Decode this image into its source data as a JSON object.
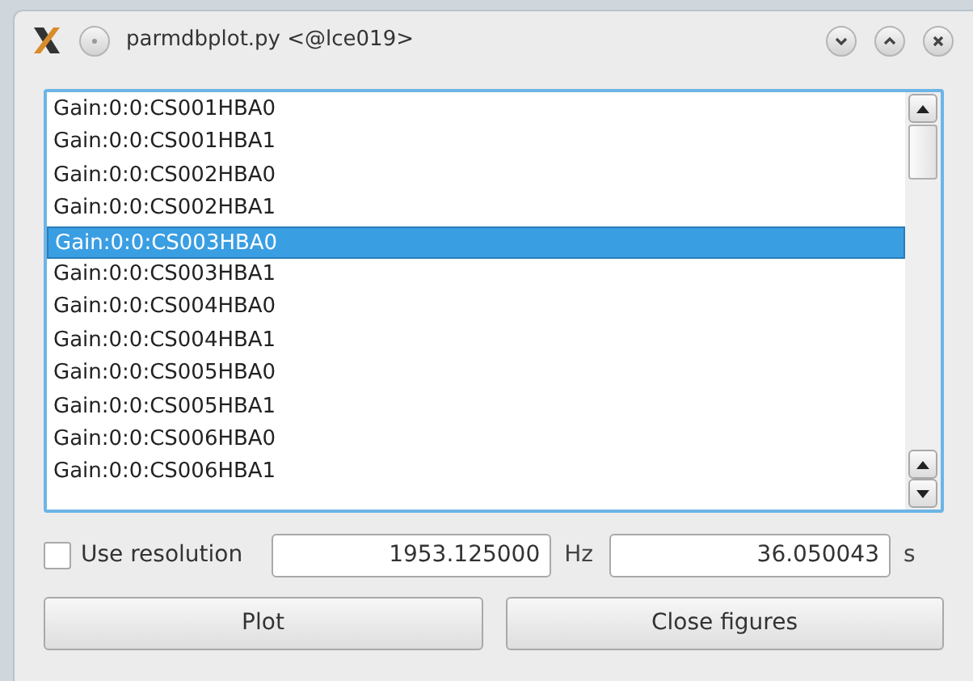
{
  "window": {
    "title": "parmdbplot.py <@lce019>"
  },
  "list": {
    "items": [
      {
        "label": "Gain:0:0:CS001HBA0",
        "selected": false
      },
      {
        "label": "Gain:0:0:CS001HBA1",
        "selected": false
      },
      {
        "label": "Gain:0:0:CS002HBA0",
        "selected": false
      },
      {
        "label": "Gain:0:0:CS002HBA1",
        "selected": false
      },
      {
        "label": "Gain:0:0:CS003HBA0",
        "selected": true
      },
      {
        "label": "Gain:0:0:CS003HBA1",
        "selected": false
      },
      {
        "label": "Gain:0:0:CS004HBA0",
        "selected": false
      },
      {
        "label": "Gain:0:0:CS004HBA1",
        "selected": false
      },
      {
        "label": "Gain:0:0:CS005HBA0",
        "selected": false
      },
      {
        "label": "Gain:0:0:CS005HBA1",
        "selected": false
      },
      {
        "label": "Gain:0:0:CS006HBA0",
        "selected": false
      },
      {
        "label": "Gain:0:0:CS006HBA1",
        "selected": false
      }
    ]
  },
  "resolution": {
    "label": "Use resolution",
    "checked": false,
    "frequency": "1953.125000",
    "frequency_unit": "Hz",
    "time": "36.050043",
    "time_unit": "s"
  },
  "buttons": [
    "Plot",
    "Close figures"
  ]
}
